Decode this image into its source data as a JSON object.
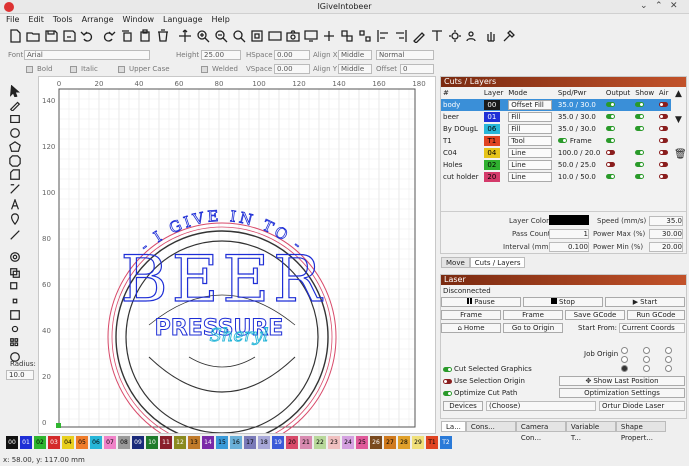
{
  "window": {
    "title": "IGiveIntobeer"
  },
  "menu": [
    "File",
    "Edit",
    "Tools",
    "Arrange",
    "Window",
    "Language",
    "Help"
  ],
  "toolbar_icons": [
    "new-file",
    "open-file",
    "save-file",
    "save-as",
    "undo",
    "redo",
    "copy",
    "paste",
    "delete",
    "move",
    "zoom-in",
    "zoom-out",
    "zoom-fit",
    "zoom-window",
    "frame-view",
    "camera",
    "monitor",
    "weld",
    "group",
    "ungroup",
    "align-left",
    "align-right",
    "pen",
    "text",
    "settings",
    "users",
    "hand",
    "tool"
  ],
  "text_options": {
    "font_label": "Font",
    "font_value": "Arial",
    "height_label": "Height",
    "height_value": "25.00",
    "hspace_label": "HSpace",
    "hspace_value": "0.00",
    "vspace_label": "VSpace",
    "vspace_value": "0.00",
    "alignx_label": "Align X",
    "alignx_value": "Middle",
    "aligny_label": "Align Y",
    "aligny_value": "Middle",
    "mode_value": "Normal",
    "offset_label": "Offset",
    "offset_value": "0",
    "bold": "Bold",
    "italic": "Italic",
    "upper": "Upper Case",
    "welded": "Welded"
  },
  "radius": {
    "label": "Radius:",
    "value": "10.0"
  },
  "ruler": {
    "x": [
      "0",
      "20",
      "40",
      "60",
      "80",
      "100",
      "120",
      "140",
      "160",
      "180"
    ],
    "y": [
      "140",
      "120",
      "100",
      "80",
      "60",
      "40",
      "20",
      "0"
    ]
  },
  "art": {
    "top_text": "- I GIVE IN TO -",
    "big": "BEER",
    "sub": "PRESSURE",
    "script": "Sheryl"
  },
  "cuts": {
    "title": "Cuts / Layers",
    "headers": [
      "#",
      "Layer",
      "Mode",
      "Spd/Pwr",
      "Output",
      "Show",
      "Air"
    ],
    "rows": [
      {
        "name": "body",
        "layer": "00",
        "color": "#1a1a1a",
        "mode": "Offset Fill",
        "spd": "35.0 / 30.0",
        "out": true,
        "show": true,
        "air": false,
        "sel": true
      },
      {
        "name": "beer",
        "layer": "01",
        "color": "#1f2fd6",
        "mode": "Fill",
        "spd": "35.0 / 30.0",
        "out": true,
        "show": true,
        "air": false
      },
      {
        "name": "By DOugL",
        "layer": "06",
        "color": "#27b6d8",
        "mode": "Fill",
        "spd": "35.0 / 30.0",
        "out": true,
        "show": true,
        "air": false
      },
      {
        "name": "T1",
        "layer": "T1",
        "color": "#e04422",
        "mode": "Tool",
        "spd": "Frame",
        "out": true,
        "show": false,
        "air": false
      },
      {
        "name": "C04",
        "layer": "04",
        "color": "#e6c41a",
        "mode": "Line",
        "spd": "100.0 / 20.0",
        "out": false,
        "show": true,
        "air": false
      },
      {
        "name": "Holes",
        "layer": "02",
        "color": "#2fb02f",
        "mode": "Line",
        "spd": "50.0 / 25.0",
        "out": false,
        "show": true,
        "air": false
      },
      {
        "name": "cut holder",
        "layer": "20",
        "color": "#d43a6a",
        "mode": "Line",
        "spd": "10.0 / 50.0",
        "out": true,
        "show": true,
        "air": false
      }
    ]
  },
  "layer_props": {
    "layer_color": "Layer Color",
    "pass_count": "Pass Count",
    "pass_value": "1",
    "interval": "Interval (mm)",
    "interval_value": "0.100",
    "speed": "Speed (mm/s)",
    "speed_value": "35.0",
    "pmax": "Power Max (%)",
    "pmax_value": "30.00",
    "pmin": "Power Min (%)",
    "pmin_value": "20.00"
  },
  "panel_tabs": [
    "Move",
    "Cuts / Layers"
  ],
  "laser": {
    "title": "Laser",
    "status": "Disconnected",
    "pause": "Pause",
    "stop": "Stop",
    "start": "Start",
    "frame1": "Frame",
    "frame2": "Frame",
    "save_gcode": "Save GCode",
    "run_gcode": "Run GCode",
    "home": "Home",
    "goto": "Go to Origin",
    "start_from": "Start From:",
    "start_from_value": "Current Coords",
    "job_origin": "Job Origin",
    "cut_selected": "Cut Selected Graphics",
    "use_selection": "Use Selection Origin",
    "optimize": "Optimize Cut Path",
    "show_last": "Show Last Position",
    "opt_settings": "Optimization Settings",
    "devices": "Devices",
    "devices_value": "(Choose)",
    "machine": "Ortur Diode Laser"
  },
  "bottom_tabs": [
    "La...",
    "Cons...",
    "Camera Con...",
    "Variable T...",
    "Shape Propert..."
  ],
  "palette": [
    {
      "n": "00",
      "c": "#111111",
      "t": "#fff"
    },
    {
      "n": "01",
      "c": "#1e2ed6",
      "t": "#fff"
    },
    {
      "n": "02",
      "c": "#2fb52f",
      "t": "#000"
    },
    {
      "n": "03",
      "c": "#d42a2a",
      "t": "#fff"
    },
    {
      "n": "04",
      "c": "#e8cf1e",
      "t": "#000"
    },
    {
      "n": "05",
      "c": "#f07c2a",
      "t": "#000"
    },
    {
      "n": "06",
      "c": "#27b6d8",
      "t": "#000"
    },
    {
      "n": "07",
      "c": "#f082c8",
      "t": "#000"
    },
    {
      "n": "08",
      "c": "#9a9a9a",
      "t": "#000"
    },
    {
      "n": "09",
      "c": "#1a2a7a",
      "t": "#fff"
    },
    {
      "n": "10",
      "c": "#1e7a2a",
      "t": "#fff"
    },
    {
      "n": "11",
      "c": "#8a1e2a",
      "t": "#fff"
    },
    {
      "n": "12",
      "c": "#8a8a1e",
      "t": "#fff"
    },
    {
      "n": "13",
      "c": "#c07a2a",
      "t": "#000"
    },
    {
      "n": "14",
      "c": "#7a2aa8",
      "t": "#fff"
    },
    {
      "n": "15",
      "c": "#3a9ad8",
      "t": "#000"
    },
    {
      "n": "16",
      "c": "#6ab0d8",
      "t": "#000"
    },
    {
      "n": "17",
      "c": "#7a7ab8",
      "t": "#000"
    },
    {
      "n": "18",
      "c": "#a8a8d8",
      "t": "#000"
    },
    {
      "n": "19",
      "c": "#3a5ad8",
      "t": "#fff"
    },
    {
      "n": "20",
      "c": "#d84a6a",
      "t": "#000"
    },
    {
      "n": "21",
      "c": "#d88ab0",
      "t": "#000"
    },
    {
      "n": "22",
      "c": "#b8d89a",
      "t": "#000"
    },
    {
      "n": "23",
      "c": "#f0c0c0",
      "t": "#000"
    },
    {
      "n": "24",
      "c": "#d4a0e0",
      "t": "#000"
    },
    {
      "n": "25",
      "c": "#e05a9a",
      "t": "#000"
    },
    {
      "n": "26",
      "c": "#7a4a1e",
      "t": "#fff"
    },
    {
      "n": "27",
      "c": "#d07a1e",
      "t": "#000"
    },
    {
      "n": "28",
      "c": "#e0a02a",
      "t": "#000"
    },
    {
      "n": "29",
      "c": "#f0e07a",
      "t": "#000"
    },
    {
      "n": "T1",
      "c": "#e04422",
      "t": "#000"
    },
    {
      "n": "T2",
      "c": "#2a7ad8",
      "t": "#fff"
    }
  ],
  "status": "x: 58.00, y: 117.00 mm"
}
